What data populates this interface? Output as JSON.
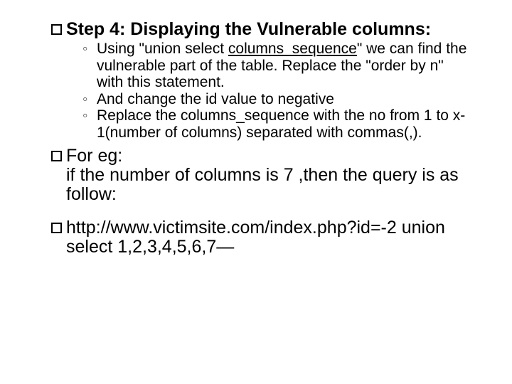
{
  "block1": {
    "title_prefix": "Step 4: Displaying the Vulnerable columns:",
    "sub": [
      {
        "before": "Using \"union select ",
        "underlined": "columns_sequence",
        "after": "\" we can find the vulnerable part of the table. Replace the \"order by n\" with this statement."
      },
      {
        "text": "And change the id value to negative"
      },
      {
        "text": "Replace the columns_sequence with the no from 1 to x-1(number of columns) separated with commas(,)."
      }
    ]
  },
  "block2": {
    "line1": "For eg:",
    "line2": "if the number of columns is 7 ,then the query is as follow:"
  },
  "block3": {
    "text": "http://www.victimsite.com/index.php?id=-2 union select 1,2,3,4,5,6,7—"
  }
}
